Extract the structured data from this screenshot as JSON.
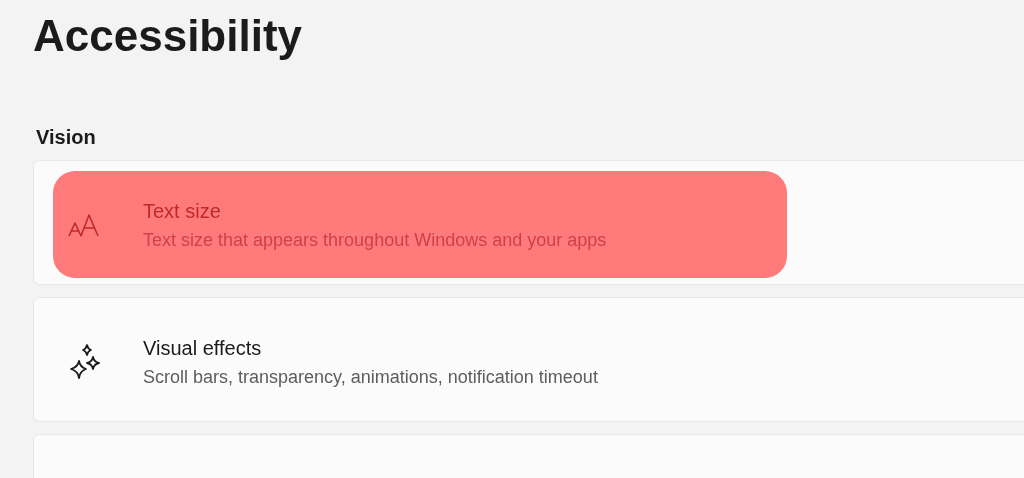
{
  "page_title": "Accessibility",
  "section": "Vision",
  "items": [
    {
      "kind": "text-size",
      "title": "Text size",
      "description": "Text size that appears throughout Windows and your apps",
      "highlighted": true
    },
    {
      "kind": "sparkle",
      "title": "Visual effects",
      "description": "Scroll bars, transparency, animations, notification timeout",
      "highlighted": false
    }
  ]
}
